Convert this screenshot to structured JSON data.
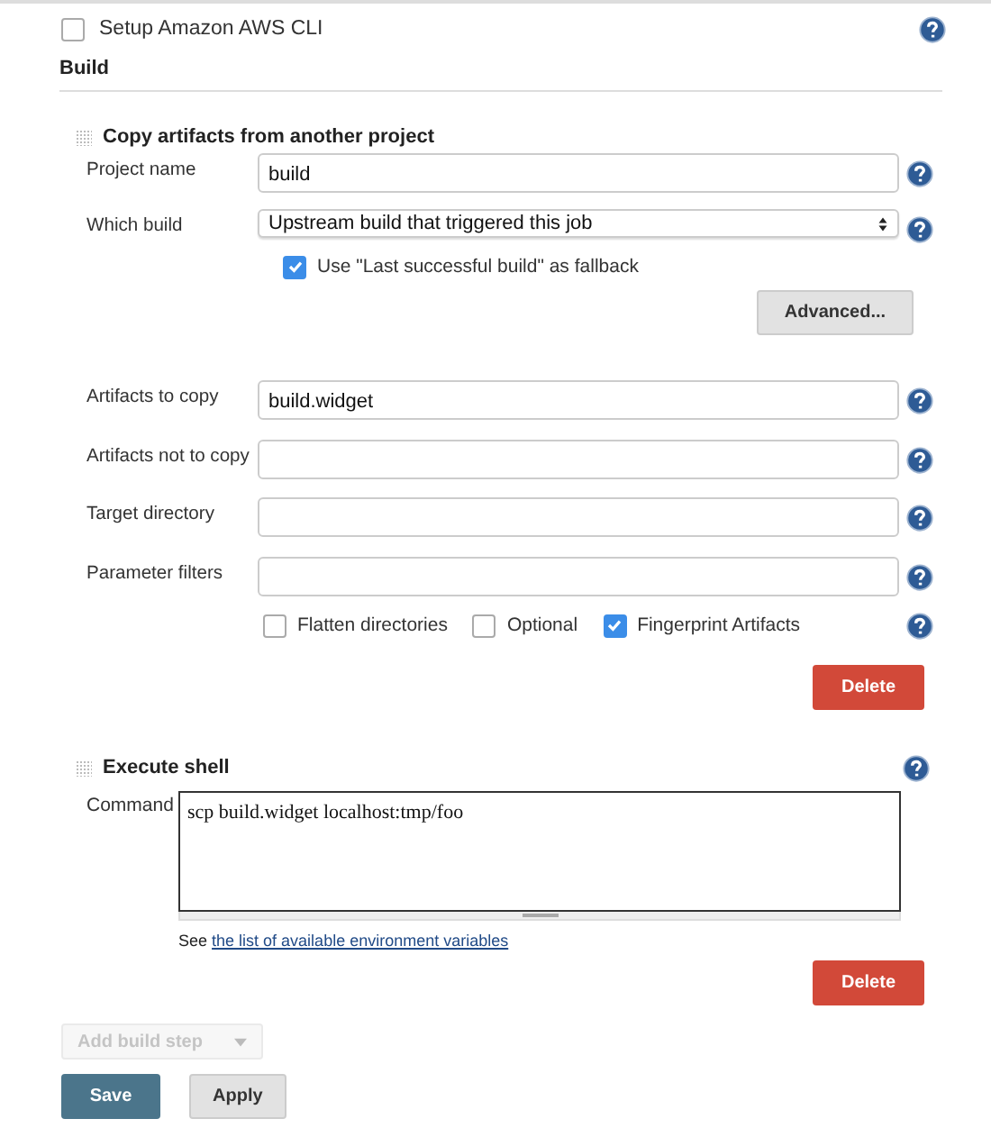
{
  "top_option": {
    "label": "Setup Amazon AWS CLI",
    "checked": false
  },
  "section": {
    "title": "Build"
  },
  "copy_artifacts": {
    "title": "Copy artifacts from another project",
    "fields": [
      {
        "kind": "text",
        "label": "Project name",
        "value": "build"
      },
      {
        "kind": "select",
        "label": "Which build",
        "value": "Upstream build that triggered this job"
      }
    ],
    "fallback": {
      "label": "Use \"Last successful build\" as fallback",
      "checked": true
    },
    "advanced_button": "Advanced...",
    "artifact_fields": [
      {
        "label": "Artifacts to copy",
        "value": "build.widget"
      },
      {
        "label": "Artifacts not to copy"
      },
      {
        "label": "Target directory"
      },
      {
        "label": "Parameter filters"
      }
    ],
    "options": [
      {
        "label": "Flatten directories",
        "checked": false
      },
      {
        "label": "Optional",
        "checked": false
      },
      {
        "label": "Fingerprint Artifacts",
        "checked": true
      }
    ],
    "delete_button": "Delete"
  },
  "execute_shell": {
    "title": "Execute shell",
    "command_label": "Command",
    "command": "scp build.widget localhost:tmp/foo",
    "note_prefix": "See",
    "note_link": "the list of available environment variables",
    "delete_button": "Delete"
  },
  "add_step_button": "Add build step",
  "buttons": [
    {
      "kind": "primary",
      "label": "Save"
    },
    {
      "kind": "secondary",
      "label": "Apply"
    }
  ]
}
